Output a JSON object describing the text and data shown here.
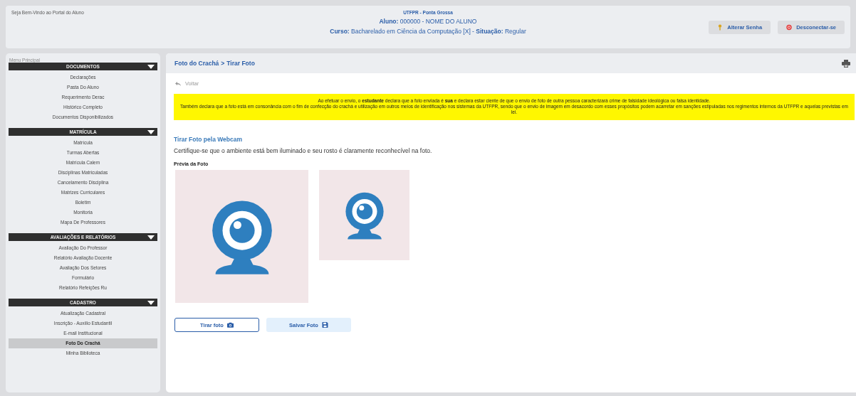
{
  "header": {
    "welcome": "Seja Bem-Vindo ao Portal do Aluno",
    "campus": "UTFPR - Ponta Grossa",
    "student": "**Aluno:** 000000 - NOME DO ALUNO",
    "course": "**Curso:** Bacharelado em Ciência da Computação [X] - **Situação:** Regular",
    "buttons": [
      {
        "label": "Alterar Senha",
        "kind": "key"
      },
      {
        "label": "Desconectar-se",
        "kind": "logout"
      }
    ]
  },
  "sidebar": {
    "title": "Menu Principal",
    "sections": [
      {
        "title": "DOCUMENTOS",
        "expanded": true,
        "items": [
          {
            "label": "Declarações",
            "selected": false
          },
          {
            "label": "Pasta Do Aluno",
            "selected": false
          },
          {
            "label": "Requerimento Derac",
            "selected": false
          },
          {
            "label": "Histórico Completo",
            "selected": false
          },
          {
            "label": "Documentos Disponibilizados",
            "selected": false
          }
        ]
      },
      {
        "title": "MATRÍCULA",
        "expanded": true,
        "items": [
          {
            "label": "Matrícula",
            "selected": false
          },
          {
            "label": "Turmas Abertas",
            "selected": false
          },
          {
            "label": "Matrícula Calem",
            "selected": false
          },
          {
            "label": "Disciplinas Matriculadas",
            "selected": false
          },
          {
            "label": "Cancelamento Disciplina",
            "selected": false
          },
          {
            "label": "Matrizes Curriculares",
            "selected": false
          },
          {
            "label": "Boletim",
            "selected": false
          },
          {
            "label": "Monitoria",
            "selected": false
          },
          {
            "label": "Mapa De Professores",
            "selected": false
          }
        ]
      },
      {
        "title": "AVALIAÇÕES E RELATÓRIOS",
        "expanded": true,
        "items": [
          {
            "label": "Avaliação Do Professor",
            "selected": false
          },
          {
            "label": "Relatório Avaliação Docente",
            "selected": false
          },
          {
            "label": "Avaliação Dos Setores",
            "selected": false
          },
          {
            "label": "Formulário",
            "selected": false
          },
          {
            "label": "Relatório Refeições Ru",
            "selected": false
          }
        ]
      },
      {
        "title": "CADASTRO",
        "expanded": true,
        "items": [
          {
            "label": "Atualização Cadastral",
            "selected": false
          },
          {
            "label": "Inscrição - Auxílio Estudantil",
            "selected": false
          },
          {
            "label": "E-mail Institucional",
            "selected": false
          },
          {
            "label": "Foto Do Crachá",
            "selected": true
          },
          {
            "label": "Minha Biblioteca",
            "selected": false
          }
        ]
      }
    ]
  },
  "main": {
    "breadcrumb": [
      "Foto do Crachá",
      "Tirar Foto"
    ],
    "separator": ">",
    "back": "Voltar",
    "notice": [
      "Ao efetuar o envio, o **estudante** declara que a foto enviada é **sua** e declara estar ciente de que o envio de foto de outra pessoa caracterizará crime de falsidade ideológica ou falsa identidade.",
      "Também declara que a foto está em consonância com o fim de confecção do crachá e utilização em outros meios de identificação nos sistemas da UTFPR, sendo que o envio de imagem em desacordo com esses propósitos podem acarretar em sanções estipuladas nos regimentos internos da UTFPR e aquelas previstas em lei."
    ],
    "section_title": "Tirar Foto pela Webcam",
    "instruction": "Certifique-se que o ambiente está bem iluminado e seu rosto é claramente reconhecível na foto.",
    "preview_label": "Prévia da Foto",
    "buttons": [
      {
        "label": "Tirar foto",
        "kind": "camera"
      },
      {
        "label": "Salvar Foto",
        "kind": "save"
      }
    ]
  }
}
